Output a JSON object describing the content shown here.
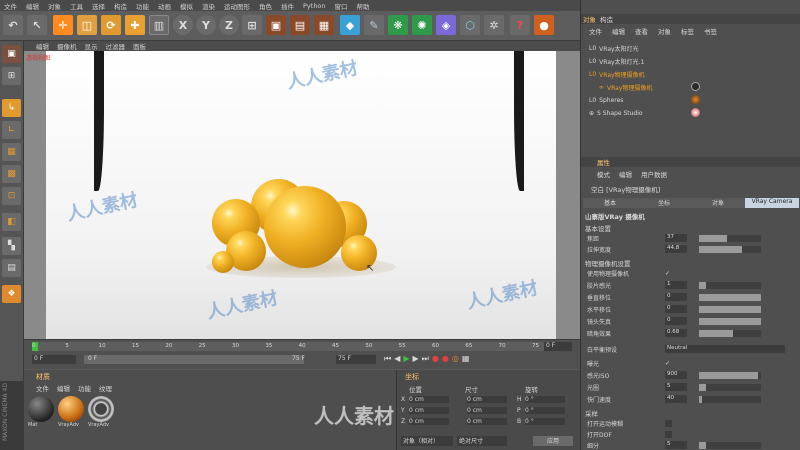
{
  "menu": [
    "文件",
    "编辑",
    "对象",
    "工具",
    "选择",
    "构造",
    "功能",
    "动画",
    "模拟",
    "渲染",
    "运动图形",
    "角色",
    "插件",
    "Python",
    "窗口",
    "帮助"
  ],
  "toolbar_axes": [
    "X",
    "Y",
    "Z"
  ],
  "viewport": {
    "menu": [
      "编辑",
      "摄像机",
      "显示",
      "过滤器",
      "面板"
    ],
    "label": "透视视图",
    "watermark": "人人素材"
  },
  "timeline": {
    "ticks": [
      "0",
      "5",
      "10",
      "15",
      "20",
      "25",
      "30",
      "35",
      "40",
      "45",
      "50",
      "55",
      "60",
      "65",
      "70",
      "75"
    ],
    "current": "0 F",
    "start": "0 F",
    "end_a": "75 F",
    "end_b": "75 F",
    "frame_box": "0 F"
  },
  "materials": {
    "tabs": [
      "材质"
    ],
    "menu": [
      "文件",
      "编辑",
      "功能",
      "纹理"
    ],
    "items": [
      "Mat",
      "VrayAdv",
      "VrayAdv"
    ]
  },
  "coords": {
    "tab": "坐标",
    "headers": [
      "位置",
      "尺寸",
      "旋转"
    ],
    "rows": [
      {
        "axis": "X",
        "pos": "0 cm",
        "size": "0 cm",
        "rot_lbl": "H",
        "rot": "0 °"
      },
      {
        "axis": "Y",
        "pos": "0 cm",
        "size": "0 cm",
        "rot_lbl": "P",
        "rot": "0 °"
      },
      {
        "axis": "Z",
        "pos": "0 cm",
        "size": "0 cm",
        "rot_lbl": "B",
        "rot": "0 °"
      }
    ],
    "mode": "对象（相对）",
    "size_mode": "绝对尺寸",
    "apply": "应用"
  },
  "right": {
    "top_tabs": [
      "对象",
      "构造"
    ],
    "obj_menu": [
      "文件",
      "编辑",
      "查看",
      "对象",
      "标签",
      "书签"
    ],
    "objects": [
      {
        "label": "VRay太阳灯光",
        "color": "#d8d8d8"
      },
      {
        "label": "VRay太阳灯光.1",
        "color": "#d8d8d8"
      },
      {
        "label": "VRay物理摄像机",
        "color": "#f0a020"
      },
      {
        "label": "VRay物理摄像机",
        "color": "#f0a020"
      },
      {
        "label": "Spheres",
        "color": "#d8d8d8"
      },
      {
        "label": "S Shape Studio",
        "color": "#d8d8d8"
      }
    ],
    "attr_tab": "属性",
    "attr_menu": [
      "模式",
      "编辑",
      "用户数据"
    ],
    "attr_title": "空白 [VRay物理摄像机]",
    "attr_tabs": [
      "基本",
      "坐标",
      "对象",
      "VRay Camera"
    ],
    "section_title": "山寨版VRay 摄像机",
    "section_basic": "基本设置",
    "basic_rows": [
      {
        "label": "焦距",
        "value": "37",
        "fill": 0.45
      },
      {
        "label": "拉伸宽度",
        "value": "44.8",
        "fill": 0.7
      }
    ],
    "section_phys": "物理摄像机设置",
    "phys_rows": [
      {
        "label": "使用物理摄像机",
        "value": "✓",
        "fill": null
      },
      {
        "label": "胶片感光",
        "value": "1",
        "fill": 0.12
      },
      {
        "label": "垂直移位",
        "value": "0",
        "fill": 1
      },
      {
        "label": "水平移位",
        "value": "0",
        "fill": 1
      },
      {
        "label": "镜头失真",
        "value": "0",
        "fill": 1
      },
      {
        "label": "暗角效果",
        "value": "0.68",
        "fill": 0.55
      }
    ],
    "wb_label": "白平衡预设",
    "wb_value": "Neutral",
    "exp_rows": [
      {
        "label": "曝光",
        "value": "✓",
        "fill": null
      },
      {
        "label": "感光ISO",
        "value": "900",
        "fill": 0.95
      },
      {
        "label": "光圈",
        "value": "5",
        "fill": 0.12
      },
      {
        "label": "快门速度",
        "value": "40",
        "fill": 0.05
      }
    ],
    "sample_title": "采样",
    "sample_rows": [
      {
        "label": "打开运动模糊",
        "value": "",
        "fill": null
      },
      {
        "label": "打开DOF",
        "value": "",
        "fill": null
      },
      {
        "label": "细分",
        "value": "5",
        "fill": 0.12
      }
    ]
  },
  "brand": {
    "maxon": "MAXON CINEMA 4D",
    "watermark": "人人素材"
  }
}
